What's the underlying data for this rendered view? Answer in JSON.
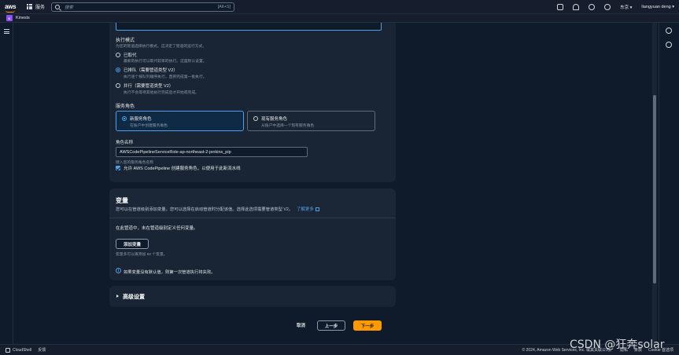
{
  "topbar": {
    "logo": "aws",
    "services": "服务",
    "search_placeholder": "搜索",
    "search_shortcut": "[Alt+S]",
    "region": "东京",
    "user": "liangyuan deng"
  },
  "subbar": {
    "service_badge": "K",
    "service_name": "Kinesis"
  },
  "execution_mode": {
    "title": "执行模式",
    "desc": "为您的管道选择执行模式。这决定了管道的运行方式。",
    "options": [
      {
        "label": "已取代",
        "desc": "最新的执行可以取代较早的执行。这是默认设置。",
        "selected": false
      },
      {
        "label": "已排队（需要管道类型 V2）",
        "desc": "执行逐个按队列顺序执行，直到完成第一批执行。",
        "selected": true
      },
      {
        "label": "并行（需要管道类型 V2）",
        "desc": "执行不会等待其他执行完成后才开始或完成。",
        "selected": false
      }
    ]
  },
  "service_role": {
    "title": "服务角色",
    "tiles": [
      {
        "label": "新服务角色",
        "desc": "在账户中创建服务角色",
        "selected": true
      },
      {
        "label": "现有服务角色",
        "desc": "从账户中选择一个现有服务角色",
        "selected": false
      }
    ]
  },
  "role_name": {
    "title": "角色名称",
    "value": "AWSCodePipelineServiceRole-ap-northeast-2-jenkins_pip",
    "hint": "键入您的服务角色名称",
    "checkbox_label": "允许 AWS CodePipeline 创建服务角色，以便用于此新流水线",
    "checked": true
  },
  "variables": {
    "title": "变量",
    "desc": "您可以在管道级别添加变量。您可以选择在启动管道时分配该值。选择此选项需要管道类型 V2。",
    "learn_more": "了解更多",
    "empty_text": "在此管道中，未在管道级别定义任何变量。",
    "add_button": "添加变量",
    "limit_hint": "变量多可以再添加 50 个变量。",
    "info": "如果变量没有默认值，则第一次管道执行将失败。"
  },
  "advanced": {
    "title": "高级设置"
  },
  "actions": {
    "cancel": "取消",
    "previous": "上一步",
    "next": "下一步"
  },
  "footer": {
    "cloudshell": "CloudShell",
    "feedback": "反馈",
    "copyright": "© 2024, Amazon Web Services, Inc. 或其关联公司。",
    "privacy": "隐私",
    "terms": "条款",
    "cookie": "Cookie 首选项"
  },
  "watermark": "CSDN @狂奔solar"
}
